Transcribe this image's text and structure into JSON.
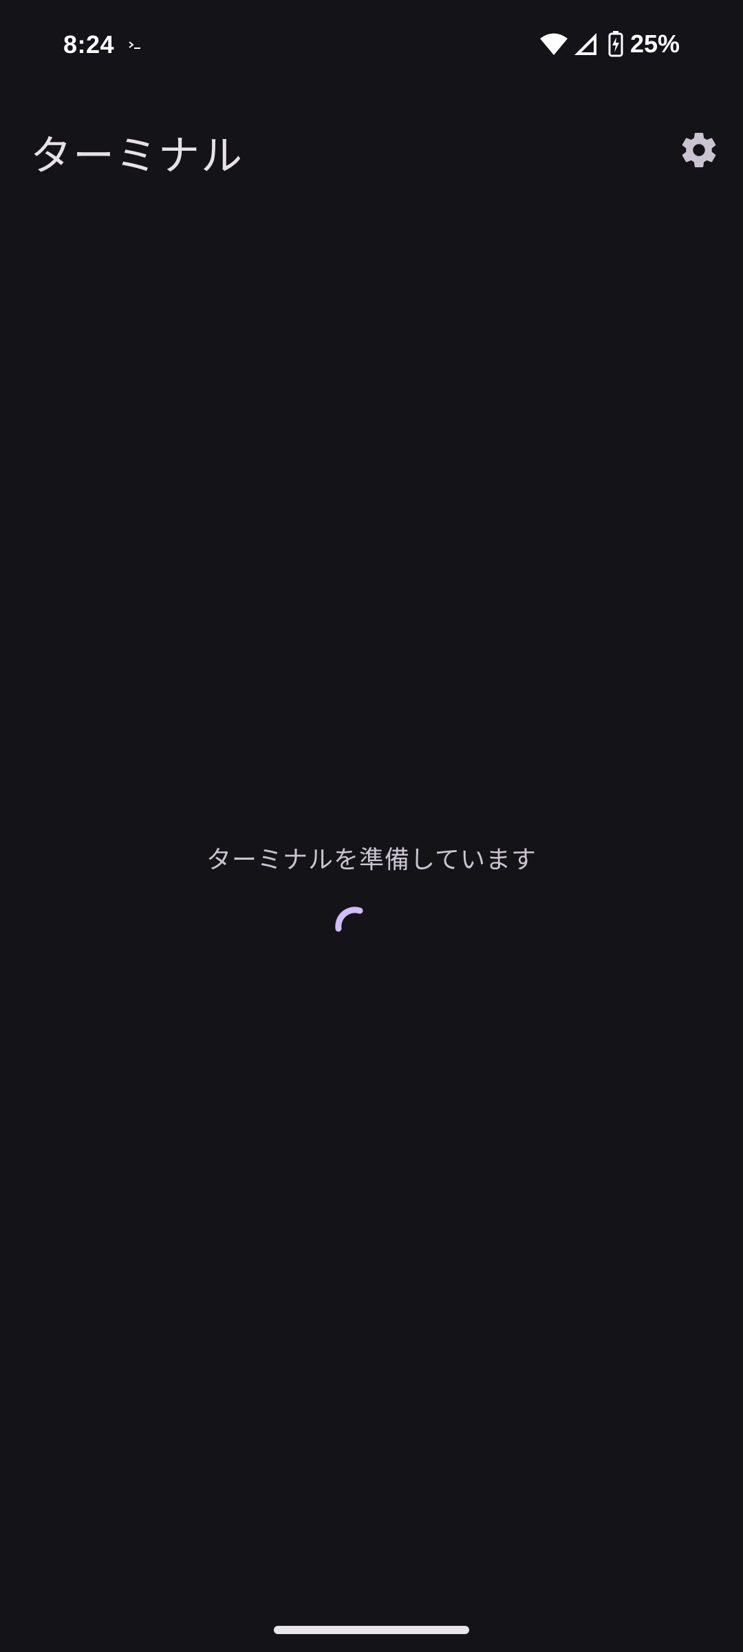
{
  "status_bar": {
    "time": "8:24",
    "battery_percent": "25%",
    "icons": [
      "terminal-notification-icon",
      "wifi-icon",
      "cell-signal-icon",
      "battery-charging-icon"
    ]
  },
  "app_bar": {
    "title": "ターミナル",
    "settings_icon": "gear-icon"
  },
  "content": {
    "loading_message": "ターミナルを準備しています"
  },
  "colors": {
    "background": "#141318",
    "on_surface": "#e6e1e9",
    "spinner_accent": "#d0bcff"
  }
}
